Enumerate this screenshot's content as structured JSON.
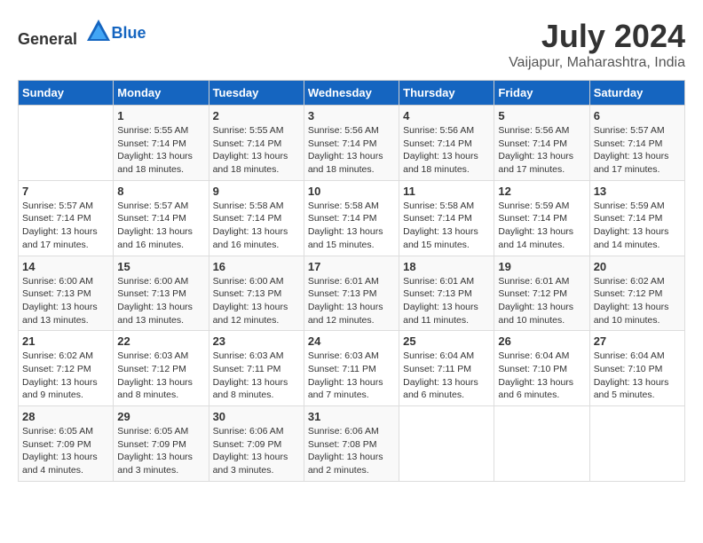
{
  "header": {
    "logo_general": "General",
    "logo_blue": "Blue",
    "title": "July 2024",
    "subtitle": "Vaijapur, Maharashtra, India"
  },
  "days_of_week": [
    "Sunday",
    "Monday",
    "Tuesday",
    "Wednesday",
    "Thursday",
    "Friday",
    "Saturday"
  ],
  "weeks": [
    [
      {
        "day": "",
        "info": ""
      },
      {
        "day": "1",
        "info": "Sunrise: 5:55 AM\nSunset: 7:14 PM\nDaylight: 13 hours\nand 18 minutes."
      },
      {
        "day": "2",
        "info": "Sunrise: 5:55 AM\nSunset: 7:14 PM\nDaylight: 13 hours\nand 18 minutes."
      },
      {
        "day": "3",
        "info": "Sunrise: 5:56 AM\nSunset: 7:14 PM\nDaylight: 13 hours\nand 18 minutes."
      },
      {
        "day": "4",
        "info": "Sunrise: 5:56 AM\nSunset: 7:14 PM\nDaylight: 13 hours\nand 18 minutes."
      },
      {
        "day": "5",
        "info": "Sunrise: 5:56 AM\nSunset: 7:14 PM\nDaylight: 13 hours\nand 17 minutes."
      },
      {
        "day": "6",
        "info": "Sunrise: 5:57 AM\nSunset: 7:14 PM\nDaylight: 13 hours\nand 17 minutes."
      }
    ],
    [
      {
        "day": "7",
        "info": "Sunrise: 5:57 AM\nSunset: 7:14 PM\nDaylight: 13 hours\nand 17 minutes."
      },
      {
        "day": "8",
        "info": "Sunrise: 5:57 AM\nSunset: 7:14 PM\nDaylight: 13 hours\nand 16 minutes."
      },
      {
        "day": "9",
        "info": "Sunrise: 5:58 AM\nSunset: 7:14 PM\nDaylight: 13 hours\nand 16 minutes."
      },
      {
        "day": "10",
        "info": "Sunrise: 5:58 AM\nSunset: 7:14 PM\nDaylight: 13 hours\nand 15 minutes."
      },
      {
        "day": "11",
        "info": "Sunrise: 5:58 AM\nSunset: 7:14 PM\nDaylight: 13 hours\nand 15 minutes."
      },
      {
        "day": "12",
        "info": "Sunrise: 5:59 AM\nSunset: 7:14 PM\nDaylight: 13 hours\nand 14 minutes."
      },
      {
        "day": "13",
        "info": "Sunrise: 5:59 AM\nSunset: 7:14 PM\nDaylight: 13 hours\nand 14 minutes."
      }
    ],
    [
      {
        "day": "14",
        "info": "Sunrise: 6:00 AM\nSunset: 7:13 PM\nDaylight: 13 hours\nand 13 minutes."
      },
      {
        "day": "15",
        "info": "Sunrise: 6:00 AM\nSunset: 7:13 PM\nDaylight: 13 hours\nand 13 minutes."
      },
      {
        "day": "16",
        "info": "Sunrise: 6:00 AM\nSunset: 7:13 PM\nDaylight: 13 hours\nand 12 minutes."
      },
      {
        "day": "17",
        "info": "Sunrise: 6:01 AM\nSunset: 7:13 PM\nDaylight: 13 hours\nand 12 minutes."
      },
      {
        "day": "18",
        "info": "Sunrise: 6:01 AM\nSunset: 7:13 PM\nDaylight: 13 hours\nand 11 minutes."
      },
      {
        "day": "19",
        "info": "Sunrise: 6:01 AM\nSunset: 7:12 PM\nDaylight: 13 hours\nand 10 minutes."
      },
      {
        "day": "20",
        "info": "Sunrise: 6:02 AM\nSunset: 7:12 PM\nDaylight: 13 hours\nand 10 minutes."
      }
    ],
    [
      {
        "day": "21",
        "info": "Sunrise: 6:02 AM\nSunset: 7:12 PM\nDaylight: 13 hours\nand 9 minutes."
      },
      {
        "day": "22",
        "info": "Sunrise: 6:03 AM\nSunset: 7:12 PM\nDaylight: 13 hours\nand 8 minutes."
      },
      {
        "day": "23",
        "info": "Sunrise: 6:03 AM\nSunset: 7:11 PM\nDaylight: 13 hours\nand 8 minutes."
      },
      {
        "day": "24",
        "info": "Sunrise: 6:03 AM\nSunset: 7:11 PM\nDaylight: 13 hours\nand 7 minutes."
      },
      {
        "day": "25",
        "info": "Sunrise: 6:04 AM\nSunset: 7:11 PM\nDaylight: 13 hours\nand 6 minutes."
      },
      {
        "day": "26",
        "info": "Sunrise: 6:04 AM\nSunset: 7:10 PM\nDaylight: 13 hours\nand 6 minutes."
      },
      {
        "day": "27",
        "info": "Sunrise: 6:04 AM\nSunset: 7:10 PM\nDaylight: 13 hours\nand 5 minutes."
      }
    ],
    [
      {
        "day": "28",
        "info": "Sunrise: 6:05 AM\nSunset: 7:09 PM\nDaylight: 13 hours\nand 4 minutes."
      },
      {
        "day": "29",
        "info": "Sunrise: 6:05 AM\nSunset: 7:09 PM\nDaylight: 13 hours\nand 3 minutes."
      },
      {
        "day": "30",
        "info": "Sunrise: 6:06 AM\nSunset: 7:09 PM\nDaylight: 13 hours\nand 3 minutes."
      },
      {
        "day": "31",
        "info": "Sunrise: 6:06 AM\nSunset: 7:08 PM\nDaylight: 13 hours\nand 2 minutes."
      },
      {
        "day": "",
        "info": ""
      },
      {
        "day": "",
        "info": ""
      },
      {
        "day": "",
        "info": ""
      }
    ]
  ]
}
